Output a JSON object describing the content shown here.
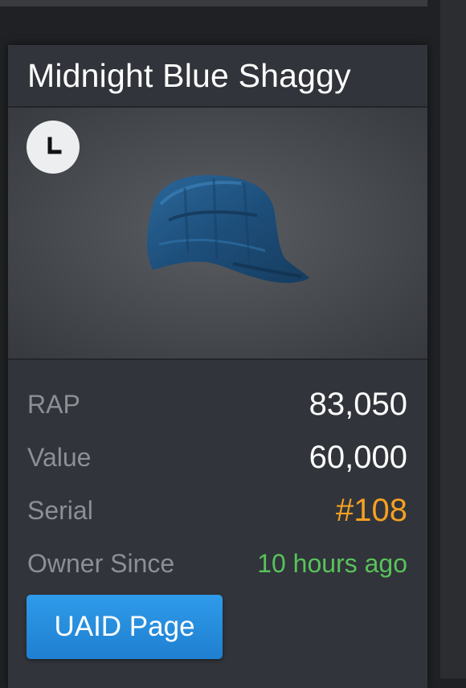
{
  "item": {
    "name": "Midnight Blue Shaggy",
    "timer_icon": "clock-icon"
  },
  "stats": {
    "rap_label": "RAP",
    "rap_value": "83,050",
    "value_label": "Value",
    "value_value": "60,000",
    "serial_label": "Serial",
    "serial_value": "#108",
    "owner_since_label": "Owner Since",
    "owner_since_value": "10 hours ago"
  },
  "actions": {
    "uaid_button_label": "UAID Page"
  },
  "colors": {
    "card_background": "#31343a",
    "serial_orange": "#f5a023",
    "owner_since_green": "#57c35b",
    "button_blue": "#2589dd",
    "hat_blue": "#1f4f7a"
  }
}
